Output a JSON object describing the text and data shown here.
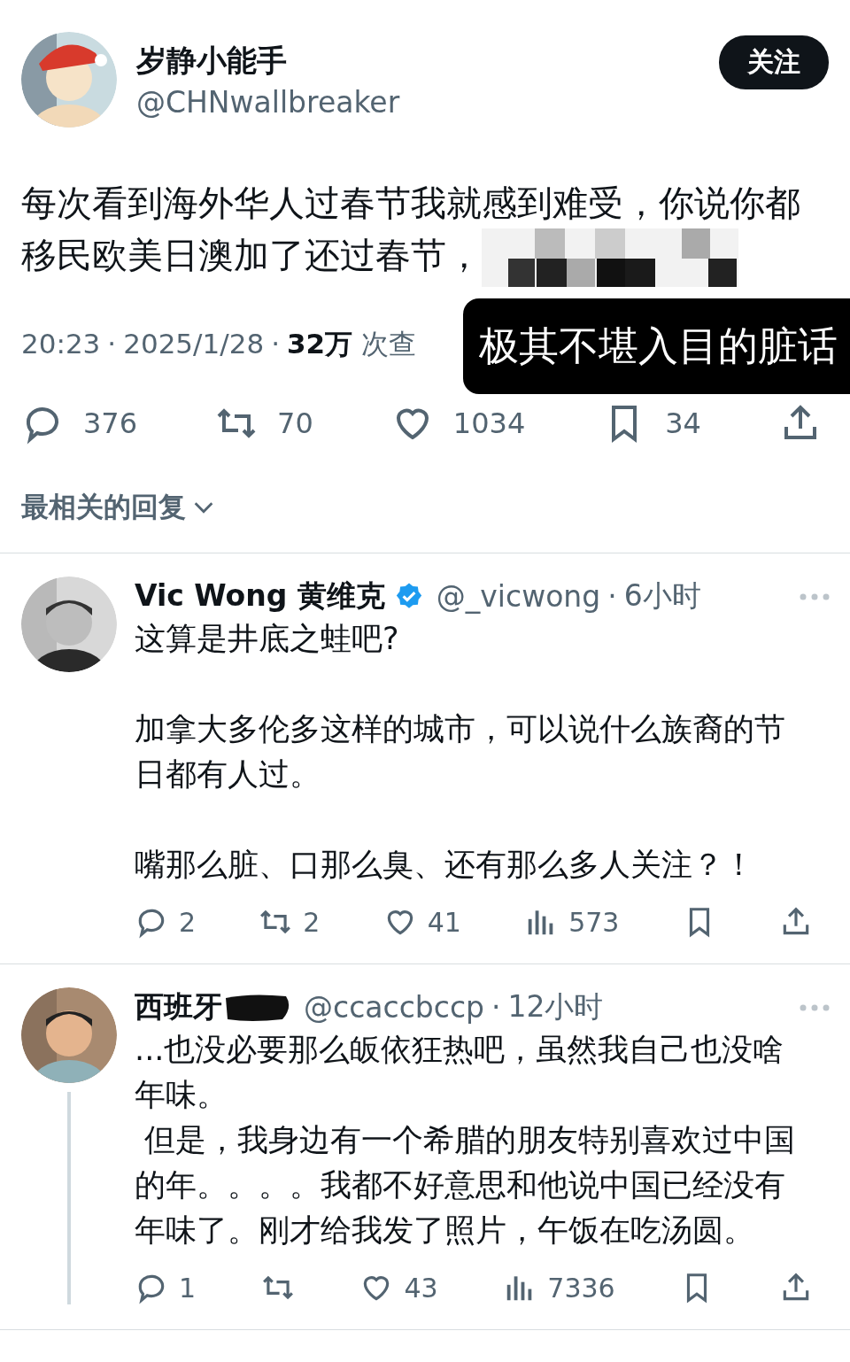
{
  "post": {
    "author": {
      "name": "岁静小能手",
      "handle": "@CHNwallbreaker"
    },
    "follow_button": "关注",
    "text": "每次看到海外华人过春节我就感到难受，你说你都移民欧美日澳加了还过春节，",
    "censored": true,
    "caption": "极其不堪入目的脏话",
    "meta": {
      "time": "20:23",
      "separator_1": "·",
      "date": "2025/1/28",
      "separator_2": "·",
      "views": "32万",
      "views_label": "次查"
    },
    "actions": [
      {
        "kind": "reply",
        "count": "376"
      },
      {
        "kind": "repost",
        "count": "70"
      },
      {
        "kind": "like",
        "count": "1034"
      },
      {
        "kind": "bookmark",
        "count": "34"
      },
      {
        "kind": "share"
      }
    ]
  },
  "sort_menu": {
    "label": "最相关的回复"
  },
  "replies": [
    {
      "name": "Vic Wong 黄维克",
      "name_redacted": false,
      "verified": true,
      "handle": "@_vicwong",
      "separator": "·",
      "time": "6小时",
      "spaced": true,
      "thread_line": false,
      "paragraphs": [
        "这算是井底之蛙吧?",
        "加拿大多伦多这样的城市，可以说什么族裔的节日都有人过。",
        "嘴那么脏、口那么臭、还有那么多人关注？！"
      ],
      "actions": [
        {
          "kind": "reply",
          "count": "2"
        },
        {
          "kind": "repost",
          "count": "2"
        },
        {
          "kind": "like",
          "count": "41"
        },
        {
          "kind": "views",
          "count": "573"
        },
        {
          "kind": "bookmark"
        },
        {
          "kind": "share"
        }
      ]
    },
    {
      "name": "西班牙",
      "name_redacted": true,
      "verified": false,
      "handle": "@ccaccbccp",
      "separator": "·",
      "time": "12小时",
      "spaced": false,
      "thread_line": true,
      "paragraphs": [
        "...也没必要那么皈依狂热吧，虽然我自己也没啥年味。",
        " 但是，我身边有一个希腊的朋友特别喜欢过中国的年。。。。我都不好意思和他说中国已经没有年味了。刚才给我发了照片，午饭在吃汤圆。"
      ],
      "actions": [
        {
          "kind": "reply",
          "count": "1"
        },
        {
          "kind": "repost"
        },
        {
          "kind": "like",
          "count": "43"
        },
        {
          "kind": "views",
          "count": "7336"
        },
        {
          "kind": "bookmark"
        },
        {
          "kind": "share"
        }
      ]
    }
  ]
}
